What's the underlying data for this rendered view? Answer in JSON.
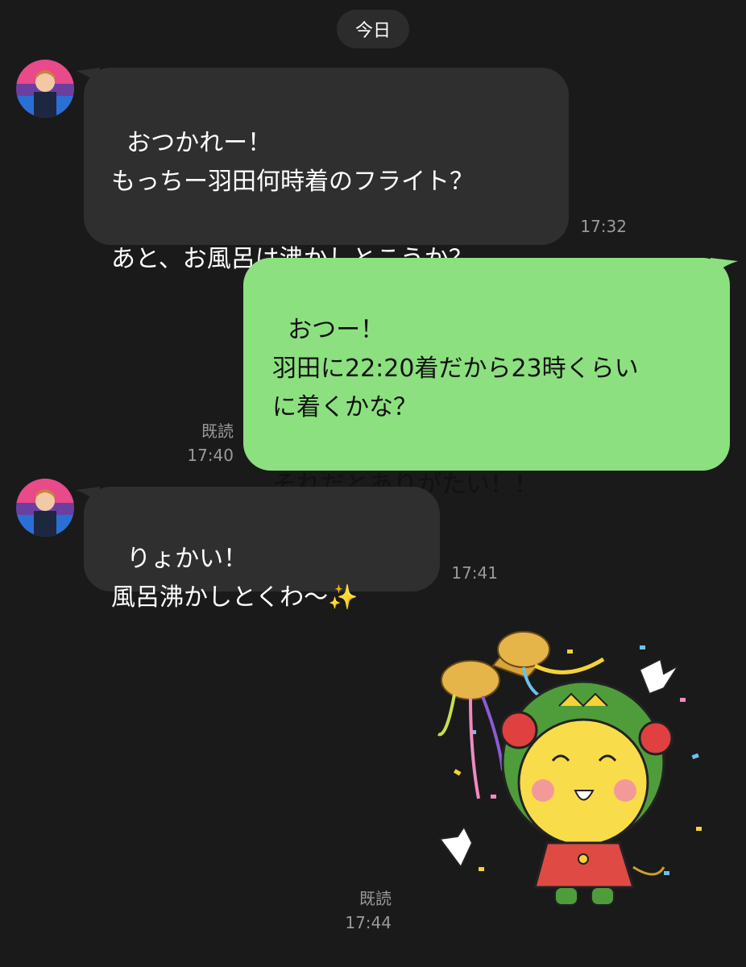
{
  "date_label": "今日",
  "messages": [
    {
      "side": "in",
      "text": "おつかれー！\nもっちー羽田何時着のフライト？\n\nあと、お風呂は沸かしとこうか？",
      "time": "17:32"
    },
    {
      "side": "out",
      "text": "おつー！\n羽田に22:20着だから23時くらい\nに着くかな？\n\nそれだとありがたい！！",
      "read": "既読",
      "time": "17:40"
    },
    {
      "side": "in",
      "text": "りょかい！\n風呂沸かしとくわ〜",
      "emoji": "✨",
      "time": "17:41"
    },
    {
      "side": "out",
      "type": "sticker",
      "sticker_name": "coronavirus-sticker-celebration",
      "read": "既読",
      "time": "17:44"
    }
  ],
  "colors": {
    "background": "#1a1a1a",
    "incoming_bubble": "#2f2f2f",
    "outgoing_bubble": "#8ce07f",
    "meta_text": "#9a9a9a"
  },
  "icons": {
    "avatar": "contact-avatar-icon",
    "sticker": "sticker-image"
  }
}
